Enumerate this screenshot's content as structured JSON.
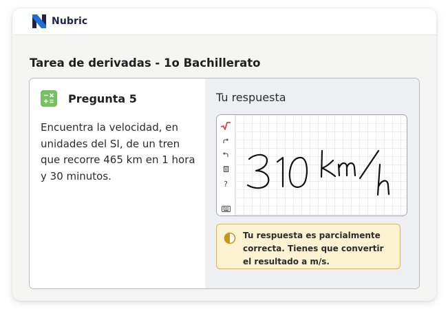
{
  "brand": {
    "name": "Nubric",
    "logo_color": "#1f6fd6"
  },
  "task": {
    "title": "Tarea de derivadas - 1o Bachillerato"
  },
  "question": {
    "label": "Pregunta 5",
    "icon": "calculator-icon",
    "icon_color": "#74c15e",
    "text": "Encuentra la velocidad, en unidades del SI, de un tren que recorre 465 km en 1 hora y 30 minutos."
  },
  "answer": {
    "title": "Tu respuesta",
    "handwritten_value": "310 km/h",
    "toolbar": [
      {
        "name": "sqrt-tool-icon",
        "glyph": "√"
      },
      {
        "name": "redo-icon",
        "glyph": "↷"
      },
      {
        "name": "undo-icon",
        "glyph": "↶"
      },
      {
        "name": "trash-icon",
        "glyph": ""
      },
      {
        "name": "help-icon",
        "glyph": "?"
      },
      {
        "name": "keyboard-icon",
        "glyph": ""
      }
    ]
  },
  "feedback": {
    "text": "Tu respuesta es parcialmente correcta. Tienes que convertir el resultado a m/s.",
    "icon": "half-circle-icon",
    "border_color": "#e3b33d",
    "background_color": "#fdf3d3"
  }
}
